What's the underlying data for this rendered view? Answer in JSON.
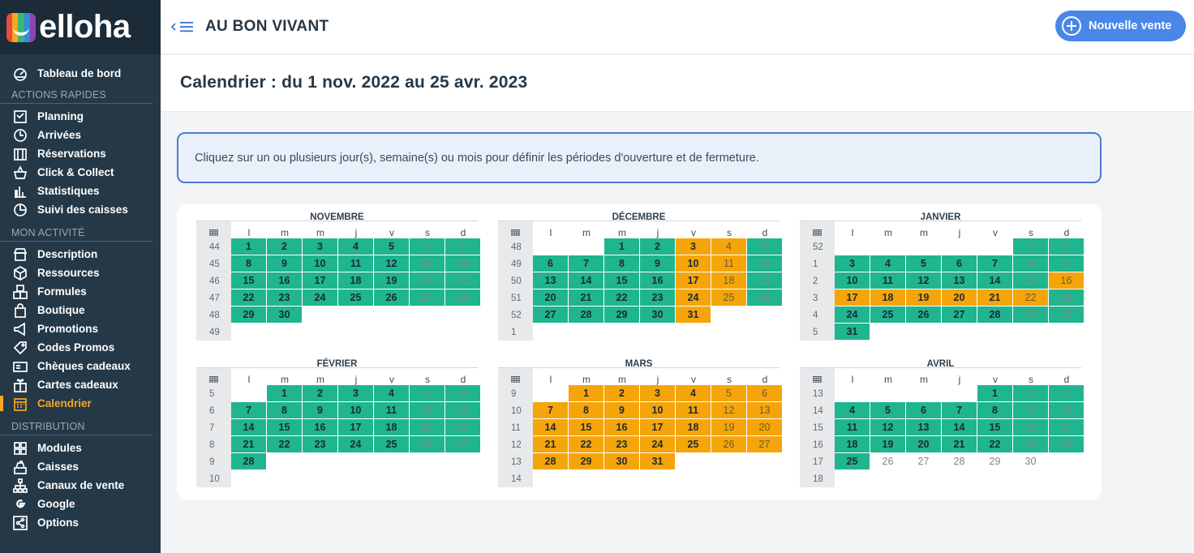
{
  "brand": {
    "logo_text": "elloha",
    "logo_colors": [
      "#e84c3d",
      "#f5a623",
      "#3db86b",
      "#2d8de0",
      "#8e44ad"
    ]
  },
  "header": {
    "shop_name": "AU BON VIVANT",
    "new_sale_label": "Nouvelle vente"
  },
  "page": {
    "title": "Calendrier : du 1 nov. 2022 au 25 avr. 2023"
  },
  "info_text": "Cliquez sur un ou plusieurs jour(s), semaine(s) ou mois pour définir les périodes d'ouverture et de fermeture.",
  "sidebar": {
    "top_item": {
      "label": "Tableau de bord",
      "icon": "dashboard-icon"
    },
    "sections": [
      {
        "title": "ACTIONS RAPIDES",
        "items": [
          {
            "label": "Planning",
            "icon": "checklist-icon"
          },
          {
            "label": "Arrivées",
            "icon": "clock-icon"
          },
          {
            "label": "Réservations",
            "icon": "booking-icon"
          },
          {
            "label": "Click & Collect",
            "icon": "basket-icon"
          },
          {
            "label": "Statistiques",
            "icon": "bar-chart-icon"
          },
          {
            "label": "Suivi des caisses",
            "icon": "pie-chart-icon"
          }
        ]
      },
      {
        "title": "MON ACTIVITÉ",
        "items": [
          {
            "label": "Description",
            "icon": "store-icon"
          },
          {
            "label": "Ressources",
            "icon": "cube-icon"
          },
          {
            "label": "Formules",
            "icon": "boxes-icon"
          },
          {
            "label": "Boutique",
            "icon": "shopping-bag-icon"
          },
          {
            "label": "Promotions",
            "icon": "megaphone-icon"
          },
          {
            "label": "Codes Promos",
            "icon": "tag-icon"
          },
          {
            "label": "Chèques cadeaux",
            "icon": "voucher-icon"
          },
          {
            "label": "Cartes cadeaux",
            "icon": "gift-icon"
          },
          {
            "label": "Calendrier",
            "icon": "calendar-icon",
            "active": true
          }
        ]
      },
      {
        "title": "DISTRIBUTION",
        "items": [
          {
            "label": "Modules",
            "icon": "modules-icon"
          },
          {
            "label": "Caisses",
            "icon": "cash-register-icon"
          },
          {
            "label": "Canaux de vente",
            "icon": "network-icon"
          },
          {
            "label": "Google",
            "icon": "google-icon"
          },
          {
            "label": "Options",
            "icon": "share-icon"
          }
        ]
      }
    ]
  },
  "calendar": {
    "day_headers": [
      "l",
      "m",
      "m",
      "j",
      "v",
      "s",
      "d"
    ],
    "week_header_icon": "grid-icon",
    "legend_colors": {
      "open": "#1fb58f",
      "closed": "#f5a50a"
    },
    "months": [
      {
        "name": "NOVEMBRE",
        "weeks": [
          44,
          45,
          46,
          47,
          48,
          49
        ],
        "first_dow": 1,
        "days": 30,
        "status": "OOOOOOOOOOOOOOOOOOOOOOOOOOOOOO"
      },
      {
        "name": "DÉCEMBRE",
        "weeks": [
          48,
          49,
          50,
          51,
          52,
          1
        ],
        "first_dow": 3,
        "days": 31,
        "status": "OOCCOOOOOCCOOOOOCCOOOOOCCOOOOOC"
      },
      {
        "name": "JANVIER",
        "weeks": [
          52,
          1,
          2,
          3,
          4,
          5
        ],
        "first_dow": 6,
        "days": 31,
        "status": "OOOOOOOOOOOOOOOCCCCCCCOOOOOOOOO"
      },
      {
        "name": "FÉVRIER",
        "weeks": [
          5,
          6,
          7,
          8,
          9,
          10
        ],
        "first_dow": 2,
        "days": 28,
        "status": "OOOOOOOOOOOOOOOOOOOOOOOOOOOO"
      },
      {
        "name": "MARS",
        "weeks": [
          9,
          10,
          11,
          12,
          13,
          14
        ],
        "first_dow": 2,
        "days": 31,
        "status": "CCCCCCCCCCCCCCCCCCCCCCCCCCCCCCC"
      },
      {
        "name": "AVRIL",
        "weeks": [
          13,
          14,
          15,
          16,
          17,
          18
        ],
        "first_dow": 5,
        "days": 30,
        "status": "OOOOOOOOOOOOOOOOOOOOOOOOONNNNN"
      }
    ]
  }
}
